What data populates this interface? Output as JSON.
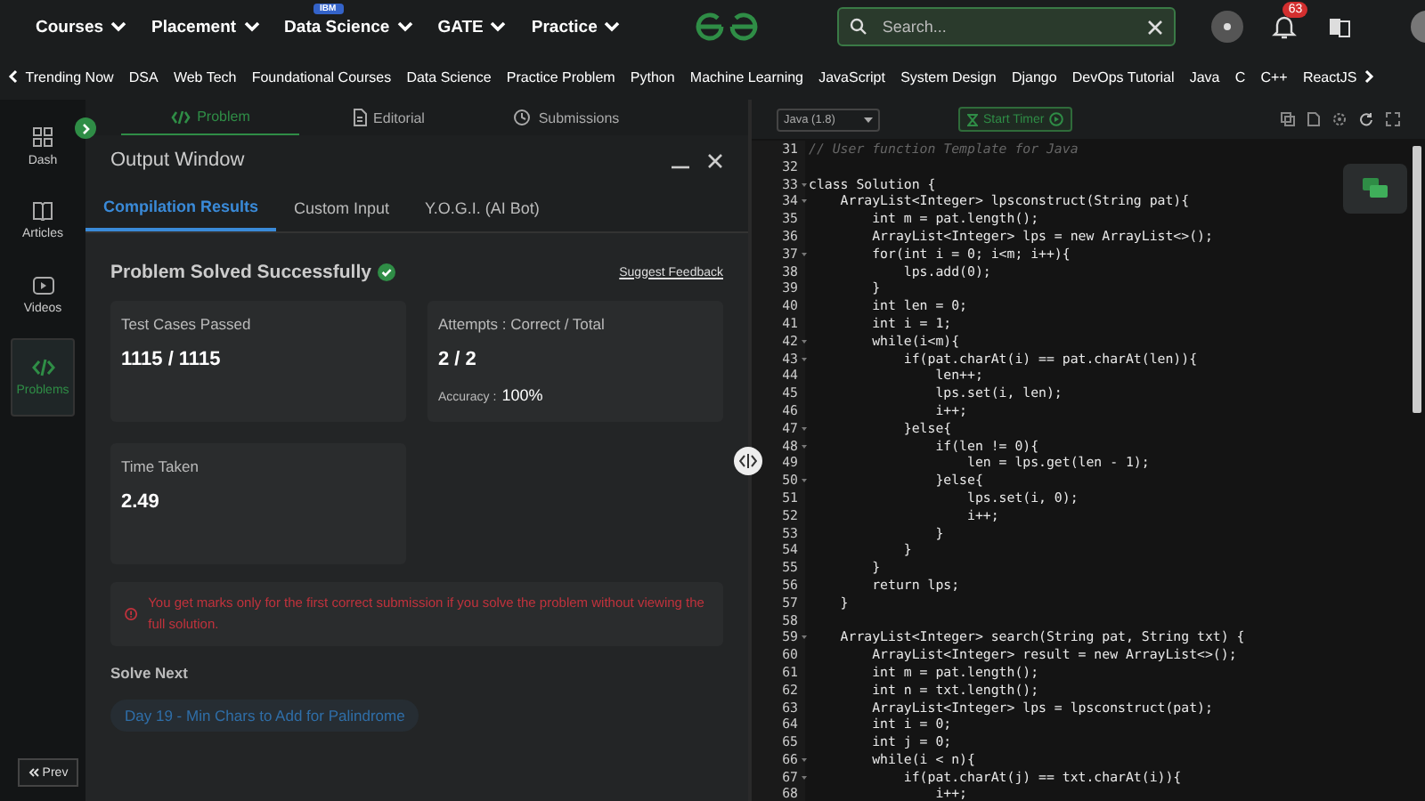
{
  "nav": {
    "items": [
      {
        "label": "Courses"
      },
      {
        "label": "Placement"
      },
      {
        "label": "Data Science",
        "badge": "IBM"
      },
      {
        "label": "GATE"
      },
      {
        "label": "Practice"
      }
    ],
    "search": {
      "placeholder": "Search..."
    },
    "notifications": "63"
  },
  "trending": [
    "Trending Now",
    "DSA",
    "Web Tech",
    "Foundational Courses",
    "Data Science",
    "Practice Problem",
    "Python",
    "Machine Learning",
    "JavaScript",
    "System Design",
    "Django",
    "DevOps Tutorial",
    "Java",
    "C",
    "C++",
    "ReactJS"
  ],
  "sidebar": {
    "items": [
      {
        "label": "Dash",
        "selected": false
      },
      {
        "label": "Articles",
        "selected": false
      },
      {
        "label": "Videos",
        "selected": false
      },
      {
        "label": "Problems",
        "selected": true
      }
    ],
    "prev": "Prev"
  },
  "problem_tabs": [
    {
      "label": "Problem",
      "selected": true
    },
    {
      "label": "Editorial",
      "selected": false
    },
    {
      "label": "Submissions",
      "selected": false
    }
  ],
  "output": {
    "title": "Output Window",
    "tabs": [
      {
        "label": "Compilation Results",
        "selected": true
      },
      {
        "label": "Custom Input",
        "selected": false
      },
      {
        "label": "Y.O.G.I. (AI Bot)",
        "selected": false
      }
    ],
    "status": "Problem Solved Successfully",
    "feedback": "Suggest Feedback",
    "cards": [
      {
        "label": "Test Cases Passed",
        "value": "1115 / 1115"
      },
      {
        "label": "Attempts : Correct / Total",
        "value": "2 / 2",
        "extra_label": "Accuracy :",
        "extra_value": "100%"
      },
      {
        "label": "Time Taken",
        "value": "2.49"
      }
    ],
    "notice": "You get marks only for the first correct submission if you solve the problem without viewing the full solution.",
    "solve_next": "Solve Next",
    "next_problem": "Day 19 - Min Chars to Add for Palindrome"
  },
  "editor": {
    "language": "Java (1.8)",
    "timer": "Start Timer",
    "lines": [
      {
        "n": "31",
        "text": "// User function Template for Java",
        "kind": "comment",
        "foldable": false
      },
      {
        "n": "32",
        "kind": "code",
        "foldable": false
      },
      {
        "n": "33",
        "text": "class Solution {",
        "kind": "code",
        "foldable": true
      },
      {
        "n": "34",
        "text": "    ArrayList<Integer> lpsconstruct(String pat){",
        "kind": "code",
        "foldable": true
      },
      {
        "n": "35",
        "text": "        int m = pat.length();",
        "kind": "code",
        "foldable": false
      },
      {
        "n": "36",
        "text": "        ArrayList<Integer> lps = new ArrayList<>();",
        "kind": "code",
        "foldable": false
      },
      {
        "n": "37",
        "text": "        for(int i = 0; i<m; i++){",
        "kind": "code",
        "foldable": true
      },
      {
        "n": "38",
        "text": "            lps.add(0);",
        "kind": "code",
        "foldable": false
      },
      {
        "n": "39",
        "text": "        }",
        "kind": "code",
        "foldable": false
      },
      {
        "n": "40",
        "text": "        int len = 0;",
        "kind": "code",
        "foldable": false
      },
      {
        "n": "41",
        "text": "        int i = 1;",
        "kind": "code",
        "foldable": false
      },
      {
        "n": "42",
        "text": "        while(i<m){",
        "kind": "code",
        "foldable": true
      },
      {
        "n": "43",
        "text": "            if(pat.charAt(i) == pat.charAt(len)){",
        "kind": "code",
        "foldable": true
      },
      {
        "n": "44",
        "text": "                len++;",
        "kind": "code",
        "foldable": false
      },
      {
        "n": "45",
        "text": "                lps.set(i, len);",
        "kind": "code",
        "foldable": false
      },
      {
        "n": "46",
        "text": "                i++;",
        "kind": "code",
        "foldable": false
      },
      {
        "n": "47",
        "text": "            }else{",
        "kind": "code",
        "foldable": true
      },
      {
        "n": "48",
        "text": "                if(len != 0){",
        "kind": "code",
        "foldable": true
      },
      {
        "n": "49",
        "text": "                    len = lps.get(len - 1);",
        "kind": "code",
        "foldable": false
      },
      {
        "n": "50",
        "text": "                }else{",
        "kind": "code",
        "foldable": true
      },
      {
        "n": "51",
        "text": "                    lps.set(i, 0);",
        "kind": "code",
        "foldable": false
      },
      {
        "n": "52",
        "text": "                    i++;",
        "kind": "code",
        "foldable": false
      },
      {
        "n": "53",
        "text": "                }",
        "kind": "code",
        "foldable": false
      },
      {
        "n": "54",
        "text": "            }",
        "kind": "code",
        "foldable": false
      },
      {
        "n": "55",
        "text": "        }",
        "kind": "code",
        "foldable": false
      },
      {
        "n": "56",
        "text": "        return lps;",
        "kind": "code",
        "foldable": false
      },
      {
        "n": "57",
        "text": "    }",
        "kind": "code",
        "foldable": false
      },
      {
        "n": "58",
        "kind": "code",
        "foldable": false
      },
      {
        "n": "59",
        "text": "    ArrayList<Integer> search(String pat, String txt) {",
        "kind": "code",
        "foldable": true
      },
      {
        "n": "60",
        "text": "        ArrayList<Integer> result = new ArrayList<>();",
        "kind": "code",
        "foldable": false
      },
      {
        "n": "61",
        "text": "        int m = pat.length();",
        "kind": "code",
        "foldable": false
      },
      {
        "n": "62",
        "text": "        int n = txt.length();",
        "kind": "code",
        "foldable": false
      },
      {
        "n": "63",
        "text": "        ArrayList<Integer> lps = lpsconstruct(pat);",
        "kind": "code",
        "foldable": false
      },
      {
        "n": "64",
        "text": "        int i = 0;",
        "kind": "code",
        "foldable": false
      },
      {
        "n": "65",
        "text": "        int j = 0;",
        "kind": "code",
        "foldable": false
      },
      {
        "n": "66",
        "text": "        while(i < n){",
        "kind": "code",
        "foldable": true
      },
      {
        "n": "67",
        "text": "            if(pat.charAt(j) == txt.charAt(i)){",
        "kind": "code",
        "foldable": true
      },
      {
        "n": "68",
        "text": "                i++;",
        "kind": "code",
        "foldable": false
      }
    ]
  }
}
